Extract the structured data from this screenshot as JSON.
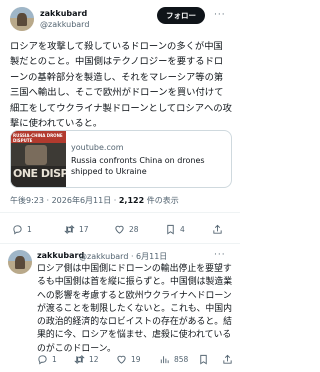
{
  "tweet": {
    "name": "zakkubard",
    "handle": "@zakkubard",
    "follow_label": "フォロー",
    "more": "···",
    "text": "ロシアを攻撃して殺しているドローンの多くが中国製だとのこと。中国側はテクノロジーを要するドローンの基幹部分を製造し、それをマレーシア等の第三国へ輸出し、そこで欧州がドローンを買い付けて細工をしてウクライナ製ドローンとしてロシアへの攻撃に使われていると。",
    "card": {
      "thumb_top_text": "RUSSIA-CHINA DRONE DISPUTE",
      "thumb_bottom_text": "ONE DISPU",
      "domain": "youtube.com",
      "title": "Russia confronts China on drones shipped to Ukraine"
    },
    "time": "午後9:23 · 2026年6月11日 · ",
    "views_count": "2,122",
    "views_label": " 件の表示",
    "actions": {
      "replies": "1",
      "retweets": "17",
      "likes": "28",
      "bookmarks": "4"
    }
  },
  "reply": {
    "name": "zakkubard",
    "handle": "@zakkubard · 6月11日",
    "more": "···",
    "text": "ロシア側は中国側にドローンの輸出停止を要望するも中国側は首を縦に振らずと。中国側は製造業への影響を考慮すると欧州ウクライナへドローンが渡ることを制限したくないと。これも、中国内の政治的経済的なロビイストの存在があると。結果的に今、ロシアを悩ませ、虐殺に使われているのがこのドローン。",
    "actions": {
      "replies": "1",
      "retweets": "12",
      "likes": "19",
      "views": "858"
    }
  },
  "colors": {
    "text": "#0f1419",
    "secondary": "#536471",
    "border": "#cfd9de",
    "button_bg": "#0f1419"
  }
}
